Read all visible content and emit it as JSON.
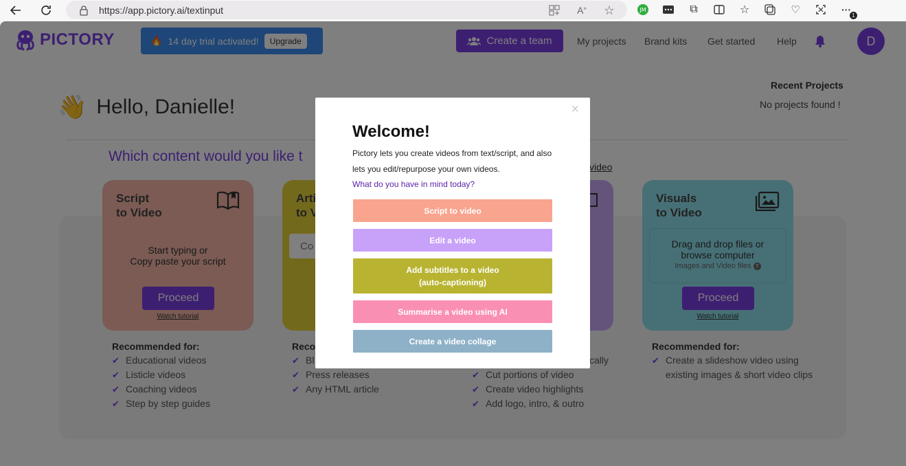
{
  "browser": {
    "url": "https://app.pictory.ai/textinput",
    "ext_badge": "1"
  },
  "nav": {
    "logo": "PICTORY",
    "trial_text": "14 day trial activated!",
    "upgrade_label": "Upgrade",
    "create_team_label": "Create a team",
    "links": [
      "My projects",
      "Brand kits",
      "Get started",
      "Help"
    ],
    "avatar_initial": "D"
  },
  "main": {
    "greeting": "Hello, Danielle!",
    "question": "Which content would you like t",
    "video_link": "video",
    "recent_title": "Recent Projects",
    "recent_empty": "No projects found !"
  },
  "cards": {
    "script": {
      "title_line1": "Script",
      "title_line2": "to Video",
      "body_line1": "Start typing or",
      "body_line2": "Copy paste your script",
      "proceed": "Proceed",
      "watch": "Watch tutorial",
      "rec_title": "Recommended for:",
      "rec_items": [
        "Educational videos",
        "Listicle videos",
        "Coaching videos",
        "Step by step guides"
      ]
    },
    "article": {
      "title_line1": "Arti",
      "title_line2": "to V",
      "input_partial": "Co",
      "rec_title": "Reco",
      "rec_items": [
        "Bl",
        "Press releases",
        "Any HTML article"
      ]
    },
    "edit": {
      "rec_items": [
        "cally",
        "Cut portions of video",
        "Create video highlights",
        "Add logo, intro, & outro"
      ]
    },
    "visuals": {
      "title_line1": "Visuals",
      "title_line2": "to Video",
      "body_line1": "Drag and drop files or",
      "body_line2": "browse computer",
      "body_hint": "Images and Video files",
      "proceed": "Proceed",
      "watch": "Watch tutorial",
      "rec_title": "Recommended for:",
      "rec_items": [
        "Create a slideshow video using existing images & short video clips"
      ]
    }
  },
  "modal": {
    "title": "Welcome!",
    "desc": "Pictory lets you create videos from text/script, and also lets you edit/repurpose your own videos.",
    "question": "What do you have in mind today?",
    "close": "×",
    "options": {
      "script": "Script to video",
      "edit": "Edit a video",
      "subtitles_line1": "Add subtitles to a video",
      "subtitles_line2": "(auto-captioning)",
      "summarise": "Summarise a video using AI",
      "collage": "Create a video collage"
    }
  },
  "colors": {
    "brand": "#7b3fe4",
    "trial": "#3d8cf0",
    "card_script": "#f6b6a8",
    "card_article": "#e6d33a",
    "card_edit": "#c8a8f8",
    "card_visuals": "#8fe0ec",
    "opt_script": "#f9a48f",
    "opt_edit": "#c8a2f9",
    "opt_subtitles": "#b8b432",
    "opt_summarise": "#fa8fb4",
    "opt_collage": "#8fb1c8"
  }
}
